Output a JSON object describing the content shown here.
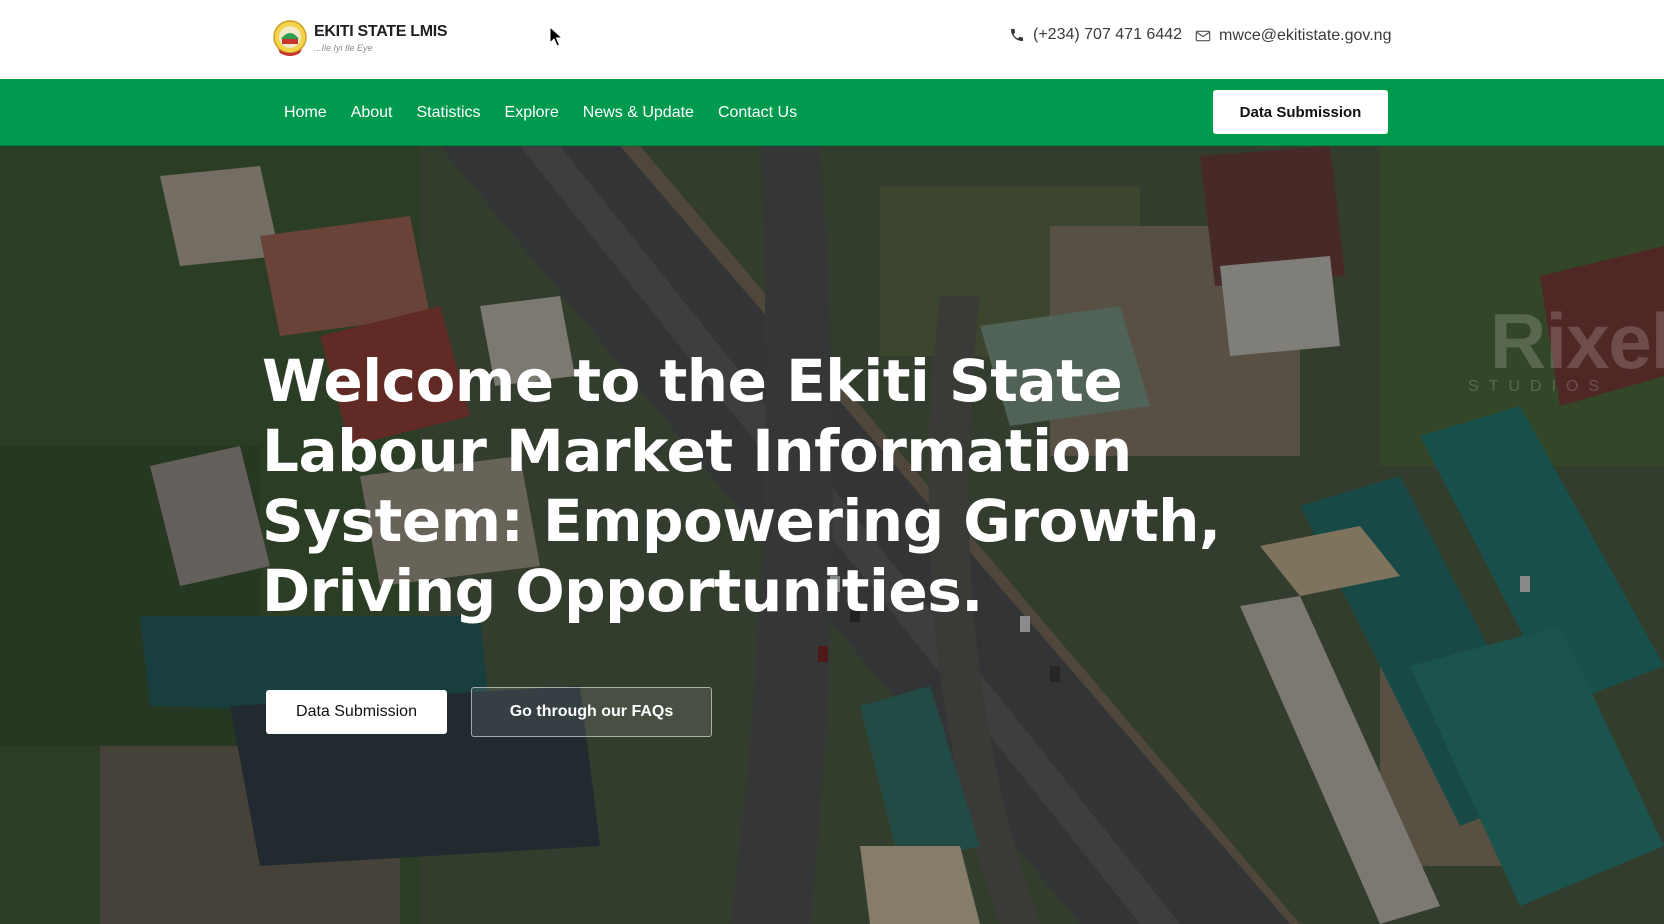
{
  "header": {
    "logo_title": "EKITI STATE LMIS",
    "logo_tagline": "...Ile Iyi Ile Eye",
    "phone": "(+234) 707 471 6442",
    "email": "mwce@ekitistate.gov.ng"
  },
  "nav": {
    "items": [
      "Home",
      "About",
      "Statistics",
      "Explore",
      "News & Update",
      "Contact Us"
    ],
    "cta_label": "Data Submission"
  },
  "hero": {
    "title": "Welcome to the Ekiti State Labour Market Information System: Empowering Growth, Driving Opportunities.",
    "primary_button": "Data Submission",
    "secondary_button": "Go through our FAQs",
    "watermark": "Rixel",
    "watermark_sub": "STUDIOS"
  },
  "colors": {
    "nav_green": "#009a4e",
    "white": "#ffffff",
    "text_dark": "#1f1f1f"
  },
  "icons": [
    "phone-icon",
    "mail-icon",
    "cursor-icon",
    "logo-seal-icon"
  ]
}
